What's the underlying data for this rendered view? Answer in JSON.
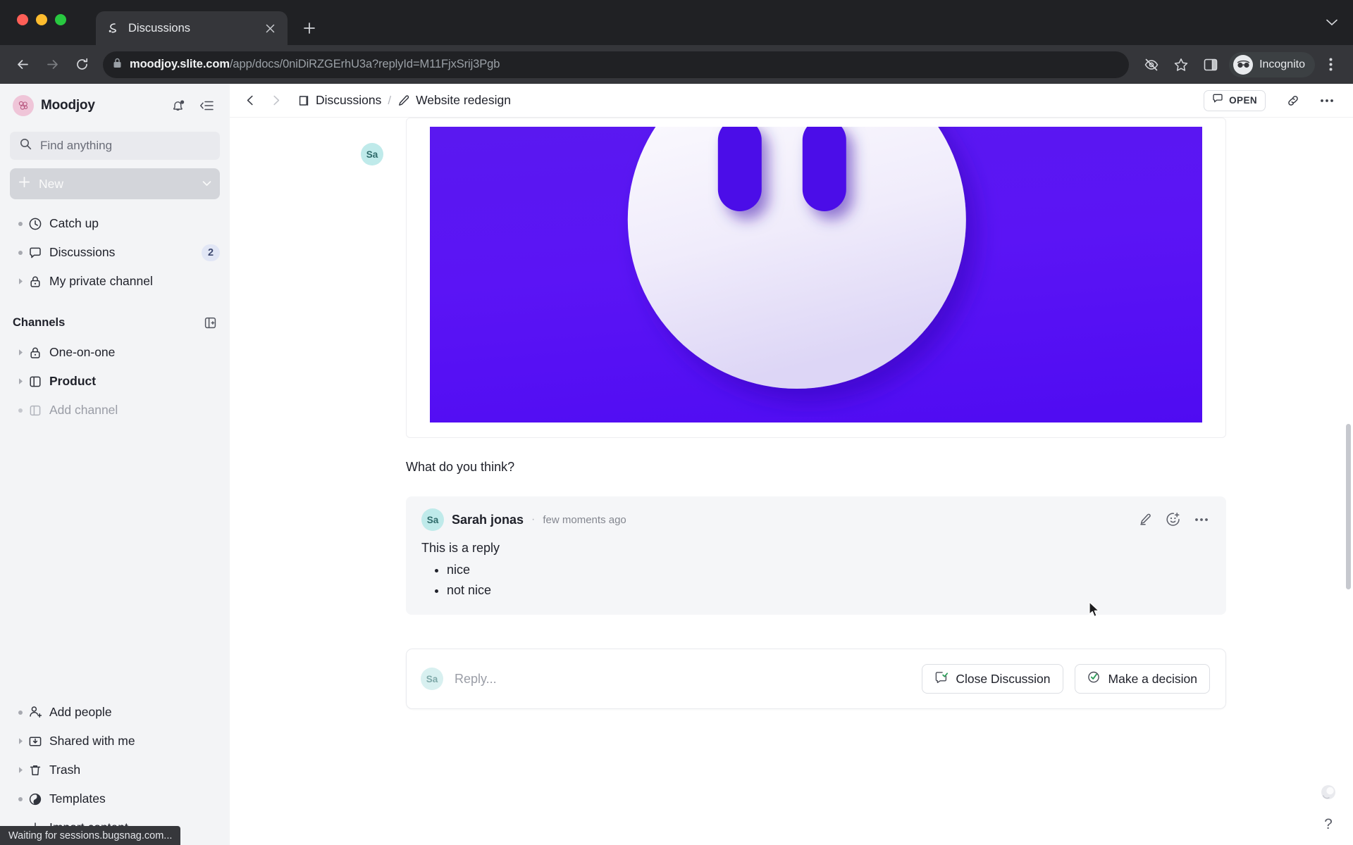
{
  "browser": {
    "tab": {
      "title": "Discussions",
      "favicon_icon": "slite-favicon",
      "close_icon": "close-icon"
    },
    "newtab_icon": "plus-icon",
    "tabstrip_caret_icon": "chevron-down-icon",
    "back_icon": "arrow-left-icon",
    "forward_icon": "arrow-right-icon",
    "reload_icon": "reload-icon",
    "lock_icon": "lock-icon",
    "url_host": "moodjoy.slite.com",
    "url_path": "/app/docs/0niDiRZGErhU3a?replyId=M11FjxSrij3Pgb",
    "url_full": "moodjoy.slite.com/app/docs/0niDiRZGErhU3a?replyId=M11FjxSrij3Pgb",
    "eye_icon": "eye-off-icon",
    "star_icon": "star-icon",
    "sidepanel_icon": "side-panel-icon",
    "incognito_label": "Incognito",
    "incognito_icon": "incognito-glasses-icon",
    "menu_icon": "kebab-menu-icon",
    "status_text": "Waiting for sessions.bugsnag.com..."
  },
  "sidebar": {
    "workspace": "Moodjoy",
    "workspace_logo_icon": "moodjoy-logo",
    "notifications_icon": "bell-icon",
    "collapse_icon": "collapse-sidebar-icon",
    "search_placeholder": "Find anything",
    "search_icon": "search-icon",
    "new_label": "New",
    "new_plus_icon": "plus-icon",
    "new_caret_icon": "chevron-down-icon",
    "nav": [
      {
        "label": "Catch up",
        "icon": "clock-icon",
        "marker": "bullet",
        "badge": ""
      },
      {
        "label": "Discussions",
        "icon": "speech-bubble-icon",
        "marker": "bullet",
        "badge": "2"
      },
      {
        "label": "My private channel",
        "icon": "lock-icon",
        "marker": "triangle",
        "badge": ""
      }
    ],
    "channels_title": "Channels",
    "channels_add_icon": "add-channel-icon",
    "channels": [
      {
        "label": "One-on-one",
        "icon": "lock-icon",
        "marker": "triangle",
        "muted": false
      },
      {
        "label": "Product",
        "icon": "channel-board-icon",
        "marker": "triangle",
        "muted": false,
        "bold": true
      },
      {
        "label": "Add channel",
        "icon": "plus-box-icon",
        "marker": "bullet",
        "muted": true
      }
    ],
    "bottom": [
      {
        "label": "Add people",
        "icon": "add-person-icon",
        "marker": "bullet"
      },
      {
        "label": "Shared with me",
        "icon": "share-inbox-icon",
        "marker": "triangle"
      },
      {
        "label": "Trash",
        "icon": "trash-icon",
        "marker": "triangle"
      },
      {
        "label": "Templates",
        "icon": "templates-icon",
        "marker": "bullet"
      },
      {
        "label": "Import content",
        "icon": "import-icon",
        "marker": "bullet"
      }
    ]
  },
  "header": {
    "back_icon": "chevron-left-icon",
    "forward_icon": "chevron-right-icon",
    "breadcrumbs": [
      {
        "label": "Discussions",
        "icon": "discussions-icon"
      },
      {
        "label": "Website redesign",
        "icon": "pencil-icon"
      }
    ],
    "separator": "/",
    "open_label": "OPEN",
    "open_icon": "discussion-status-icon",
    "link_icon": "link-icon",
    "more_icon": "more-horizontal-icon"
  },
  "document": {
    "author_initials": "Sa",
    "image_alt_icon": "smiley-face-image",
    "image_bg_color": "#5214f2",
    "paragraph": "What do you think?"
  },
  "reply": {
    "avatar_initials": "Sa",
    "author": "Sarah jonas",
    "separator_dot": "·",
    "timestamp": "few moments ago",
    "edit_icon": "edit-reply-icon",
    "emoji_icon": "add-reaction-icon",
    "more_icon": "more-horizontal-icon",
    "text": "This is a reply",
    "bullets": [
      "nice",
      "not nice"
    ]
  },
  "composer": {
    "avatar_initials": "Sa",
    "placeholder": "Reply...",
    "close_discussion_label": "Close Discussion",
    "close_discussion_icon": "close-discussion-icon",
    "make_decision_label": "Make a decision",
    "make_decision_icon": "make-decision-icon"
  },
  "floating": {
    "bubble_icon": "chat-bubble-icon",
    "help_label": "?",
    "help_icon": "help-icon"
  },
  "colors": {
    "accent_purple": "#5214f2",
    "avatar_teal": "#bfeaea",
    "badge_blue": "#e1e6f5",
    "chrome_dark": "#202124",
    "toolbar_dark": "#35363a",
    "sidebar_gray": "#f3f4f6"
  }
}
